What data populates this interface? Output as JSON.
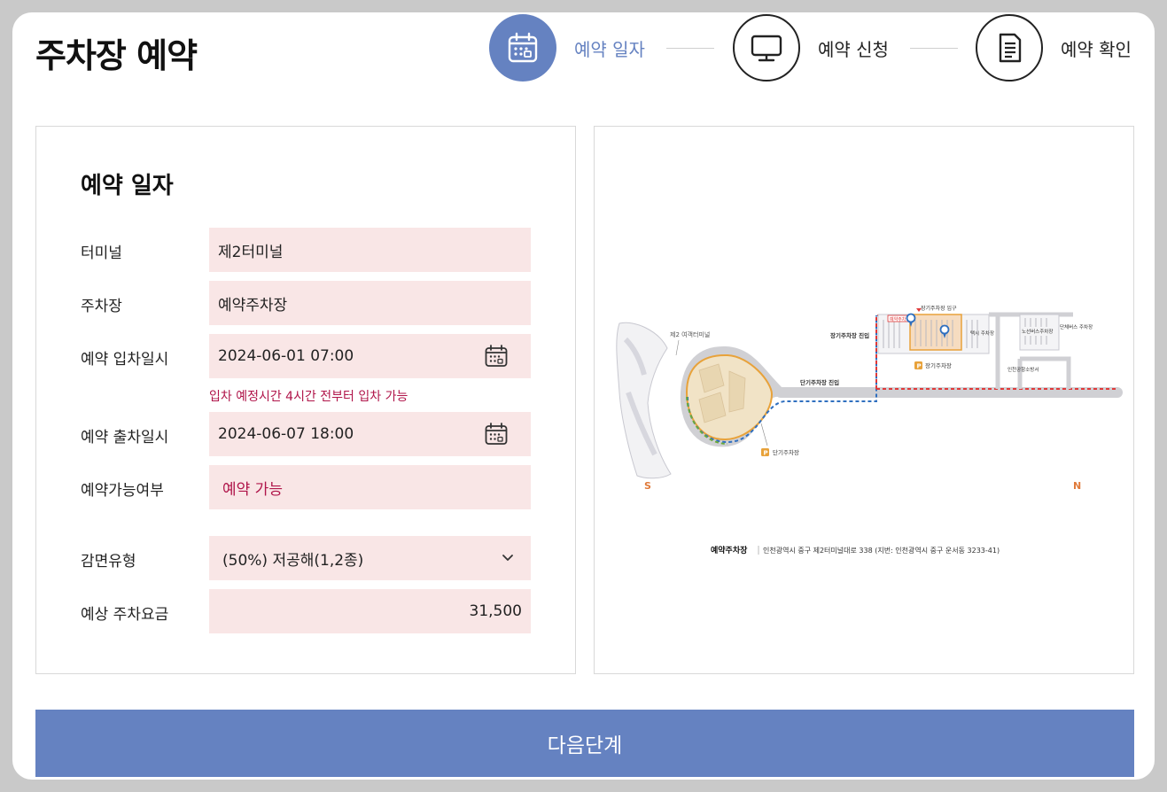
{
  "page": {
    "title": "주차장 예약"
  },
  "steps": [
    {
      "label": "예약 일자",
      "icon": "calendar-icon",
      "active": true
    },
    {
      "label": "예약 신청",
      "icon": "monitor-icon",
      "active": false
    },
    {
      "label": "예약 확인",
      "icon": "document-icon",
      "active": false
    }
  ],
  "form": {
    "title": "예약 일자",
    "terminal": {
      "label": "터미널",
      "value": "제2터미널"
    },
    "parking": {
      "label": "주차장",
      "value": "예약주차장"
    },
    "entry": {
      "label": "예약 입차일시",
      "value": "2024-06-01 07:00",
      "hint": "입차 예정시간 4시간 전부터 입차 가능"
    },
    "exit": {
      "label": "예약 출차일시",
      "value": "2024-06-07 18:00"
    },
    "availability": {
      "label": "예약가능여부",
      "value": "예약 가능"
    },
    "discount": {
      "label": "감면유형",
      "value": "(50%) 저공해(1,2종)"
    },
    "fee": {
      "label": "예상 주차요금",
      "value": "31,500"
    }
  },
  "map": {
    "terminal_label": "제2 여객터미널",
    "long_term_entry": "장기주차장 입구",
    "long_term_approach": "장기주차장 진입",
    "long_term_label": "장기주차장",
    "short_term_entry": "단기주차장 진입",
    "short_term_label": "단기주차장",
    "reserved_label": "예약주차장",
    "bus_parking": "노선버스주차장",
    "group_bus": "단체버스 주차장",
    "fire_station": "인천공항소방서",
    "taxi_parking": "택시 주차장",
    "badge_reserved": "예약주차",
    "badge_p": "P",
    "compass_s": "S",
    "compass_n": "N",
    "caption_title": "예약주차장",
    "caption_address": "인천광역시 중구 제2터미널대로 338 (지번: 인천광역시 중구 운서동 3233-41)"
  },
  "actions": {
    "next_label": "다음단계"
  },
  "colors": {
    "accent": "#6582c1",
    "field_bg": "#f9e6e6",
    "alert": "#b0154a",
    "map_orange": "#e8a23a",
    "map_red": "#e03a3a",
    "map_blue": "#2f6fbf"
  }
}
